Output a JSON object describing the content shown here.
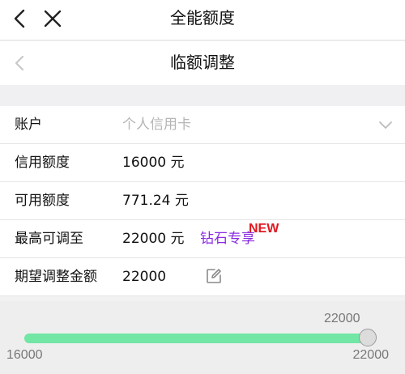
{
  "header": {
    "title": "全能额度"
  },
  "subheader": {
    "title": "临额调整"
  },
  "form": {
    "account": {
      "label": "账户",
      "placeholder": "个人信用卡"
    },
    "credit_limit": {
      "label": "信用额度",
      "value": "16000 元"
    },
    "available": {
      "label": "可用额度",
      "value": "771.24 元"
    },
    "max_adjust": {
      "label": "最高可调至",
      "value": "22000 元",
      "badge": "钻石专享",
      "badge_new": "NEW"
    },
    "expected": {
      "label": "期望调整金额",
      "value": "22000"
    }
  },
  "slider": {
    "current": "22000",
    "min": "16000",
    "max": "22000",
    "fraction": 1.0
  },
  "colors": {
    "accent_fill": "#72e6a5",
    "badge_purple": "#8a2be2",
    "badge_red": "#e0181e"
  },
  "icons": [
    "back-icon",
    "close-icon",
    "chevron-down-icon",
    "edit-icon"
  ]
}
